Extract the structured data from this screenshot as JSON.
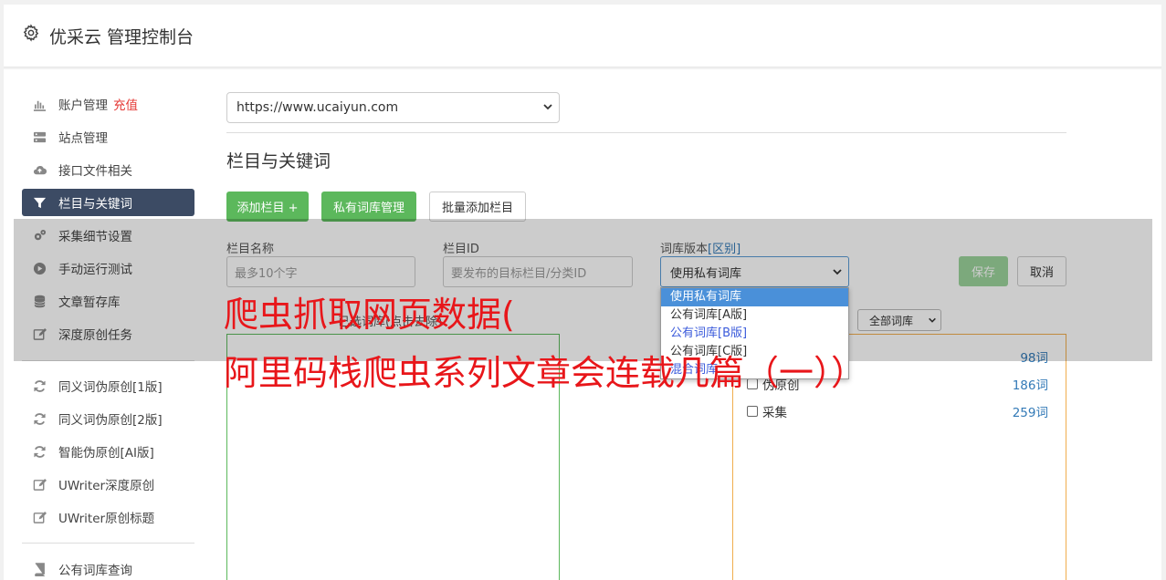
{
  "header": {
    "title": "优采云 管理控制台",
    "icon": "gear-icon"
  },
  "sidebar": {
    "items": [
      {
        "label": "账户管理",
        "badge": "充值",
        "icon": "bar-chart-icon"
      },
      {
        "label": "站点管理",
        "icon": "server-icon"
      },
      {
        "label": "接口文件相关",
        "icon": "cloud-upload-icon"
      },
      {
        "label": "栏目与关键词",
        "icon": "filter-icon",
        "active": true
      },
      {
        "label": "采集细节设置",
        "icon": "cogs-icon"
      },
      {
        "label": "手动运行测试",
        "icon": "play-circle-icon"
      },
      {
        "label": "文章暂存库",
        "icon": "database-icon"
      },
      {
        "label": "深度原创任务",
        "icon": "edit-icon"
      },
      {
        "label": "同义词伪原创[1版]",
        "icon": "refresh-icon"
      },
      {
        "label": "同义词伪原创[2版]",
        "icon": "refresh-icon"
      },
      {
        "label": "智能伪原创[AI版]",
        "icon": "refresh-icon"
      },
      {
        "label": "UWriter深度原创",
        "icon": "edit-icon"
      },
      {
        "label": "UWriter原创标题",
        "icon": "edit-icon"
      },
      {
        "label": "公有词库查询",
        "icon": "book-icon"
      }
    ]
  },
  "main": {
    "site_select": "https://www.ucaiyun.com",
    "section_title": "栏目与关键词",
    "buttons": {
      "add_column": "添加栏目 +",
      "private_lib": "私有词库管理",
      "batch_add": "批量添加栏目"
    },
    "form": {
      "name_label": "栏目名称",
      "name_placeholder": "最多10个字",
      "id_label": "栏目ID",
      "id_placeholder": "要发布的目标栏目/分类ID",
      "lib_label": "词库版本",
      "lib_label_link": "[区别]",
      "lib_value": "使用私有词库",
      "save": "保存",
      "cancel": "取消"
    },
    "lib_options": [
      "使用私有词库",
      "公有词库[A版]",
      "公有词库[B版]",
      "公有词库[C版]",
      "混合词库"
    ],
    "selected_box_label": "已选词库(点击去除)",
    "lib_filter": "全部词库",
    "lib_list": [
      {
        "name": "",
        "count": "98词"
      },
      {
        "name": "伪原创",
        "count": "186词"
      },
      {
        "name": "采集",
        "count": "259词"
      }
    ]
  },
  "watermark": {
    "line1": "爬虫抓取网页数据(",
    "line2": "阿里码栈爬虫系列文章会连载几篇（一））"
  },
  "colors": {
    "accent_green": "#5cb85c",
    "sidebar_active": "#3c4b64",
    "headline_red": "#e8161a",
    "link_blue": "#337ab7"
  }
}
